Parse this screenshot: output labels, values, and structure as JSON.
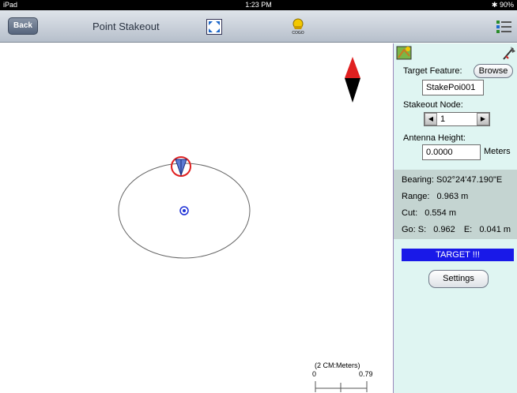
{
  "status_bar": {
    "device": "iPad",
    "time": "1:23 PM",
    "battery": "90%"
  },
  "nav": {
    "back_label": "Back",
    "title": "Point Stakeout",
    "cogo_label": "COGO"
  },
  "map": {
    "scale_label": "(2 CM:Meters)",
    "scale_min": "0",
    "scale_max": "0.79"
  },
  "panel": {
    "target_feature_label": "Target Feature:",
    "browse_label": "Browse",
    "target_feature_value": "StakePoi001",
    "stakeout_node_label": "Stakeout Node:",
    "stakeout_node_value": "1",
    "antenna_height_label": "Antenna Height:",
    "antenna_height_value": "0.0000",
    "antenna_unit": "Meters",
    "bearing": "Bearing: S02°24'47.190\"E",
    "range_label": "Range:",
    "range_value": "0.963 m",
    "cut_label": "Cut:",
    "cut_value": "0.554 m",
    "go_s_label": "Go: S:",
    "go_s_value": "0.962",
    "go_e_label": "E:",
    "go_e_value": "0.041 m",
    "target_banner": "TARGET !!!",
    "settings_label": "Settings"
  },
  "colors": {
    "target_banner": "#1919e8",
    "panel_bg": "#dff5f2",
    "info_bg": "#c4d4d1",
    "ring": "#e02020"
  }
}
